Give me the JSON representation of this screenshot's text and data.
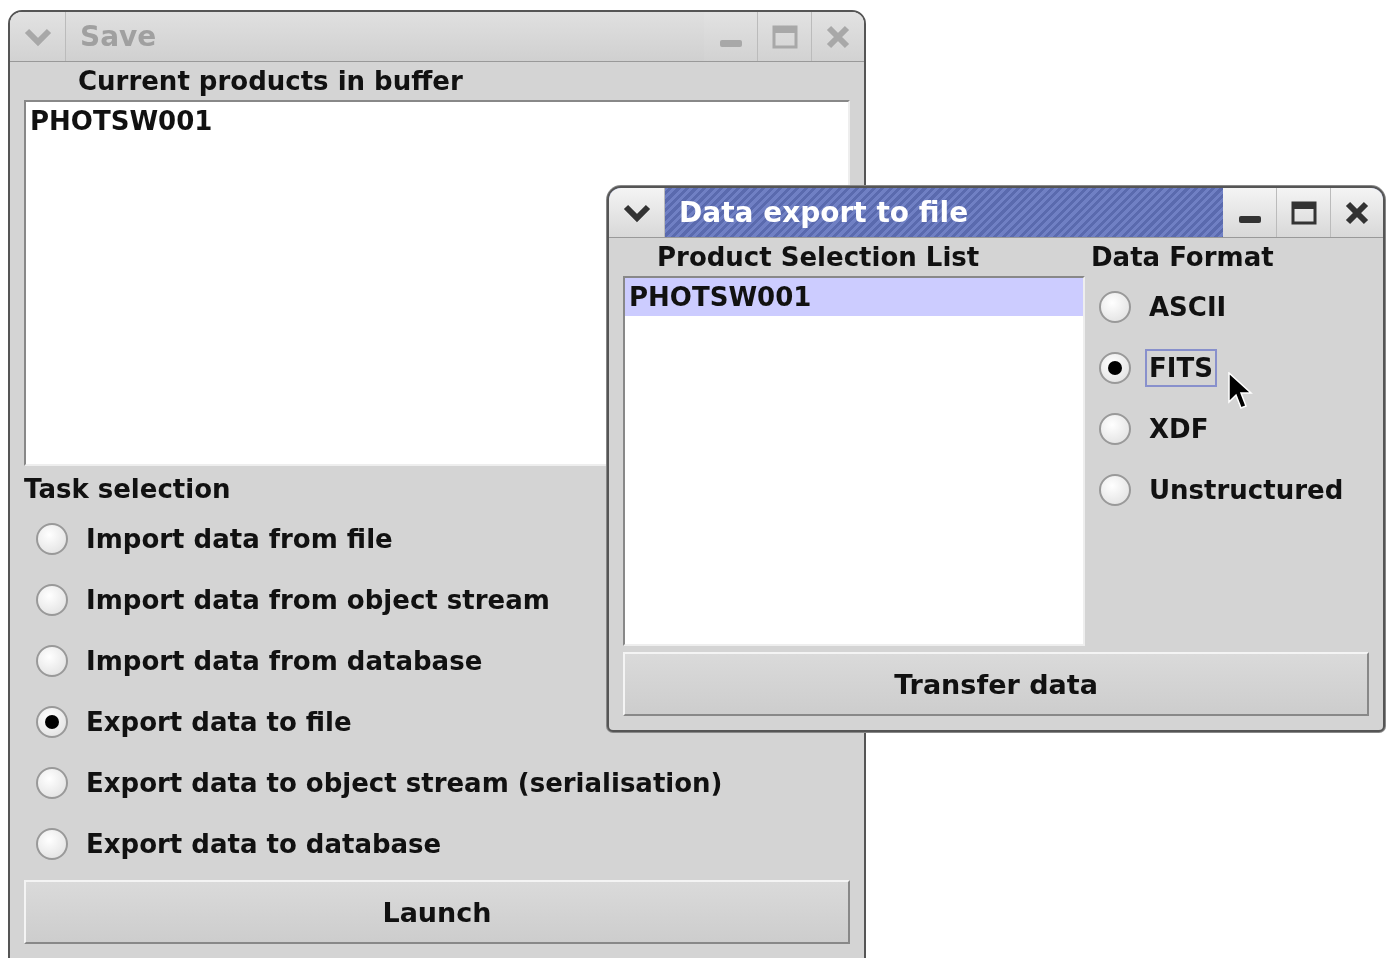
{
  "windows": [
    {
      "title": "Save",
      "active": false,
      "products_label": "Current products in buffer",
      "products": [
        {
          "name": "PHOTSW001",
          "selected": false
        }
      ],
      "task_label": "Task selection",
      "tasks": [
        {
          "label": "Import data from file",
          "selected": false
        },
        {
          "label": "Import data from object stream",
          "selected": false
        },
        {
          "label": "Import data from database",
          "selected": false
        },
        {
          "label": "Export data to file",
          "selected": true
        },
        {
          "label": "Export data to object stream (serialisation)",
          "selected": false
        },
        {
          "label": "Export data to database",
          "selected": false
        }
      ],
      "button": "Launch"
    },
    {
      "title": "Data export to file",
      "active": true,
      "list_label": "Product Selection List",
      "products": [
        {
          "name": "PHOTSW001",
          "selected": true
        }
      ],
      "format_label": "Data Format",
      "formats": [
        {
          "label": "ASCII",
          "selected": false,
          "focused": false
        },
        {
          "label": "FITS",
          "selected": true,
          "focused": true
        },
        {
          "label": "XDF",
          "selected": false,
          "focused": false
        },
        {
          "label": "Unstructured",
          "selected": false,
          "focused": false
        }
      ],
      "button": "Transfer data"
    }
  ]
}
